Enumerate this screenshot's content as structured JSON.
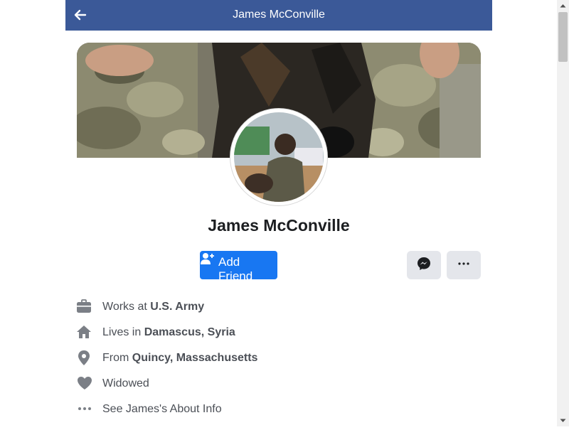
{
  "header": {
    "title": "James McConville"
  },
  "profile": {
    "name": "James McConville"
  },
  "actions": {
    "add_friend_label": "Add Friend",
    "more_label": "···"
  },
  "info": {
    "work_prefix": "Works at ",
    "work_value": "U.S. Army",
    "lives_prefix": "Lives in ",
    "lives_value": "Damascus, Syria",
    "from_prefix": "From ",
    "from_value": "Quincy, Massachusetts",
    "relationship": "Widowed",
    "about_link": "See James's About Info"
  },
  "colors": {
    "header_bg": "#3b5998",
    "primary_button": "#1877f2",
    "secondary_button": "#e4e6eb",
    "icon_grey": "#7b7f86"
  },
  "icons": [
    "back-arrow-icon",
    "add-friend-icon",
    "messenger-icon",
    "more-dots-icon",
    "briefcase-icon",
    "home-icon",
    "location-pin-icon",
    "heart-icon",
    "ellipsis-icon"
  ]
}
